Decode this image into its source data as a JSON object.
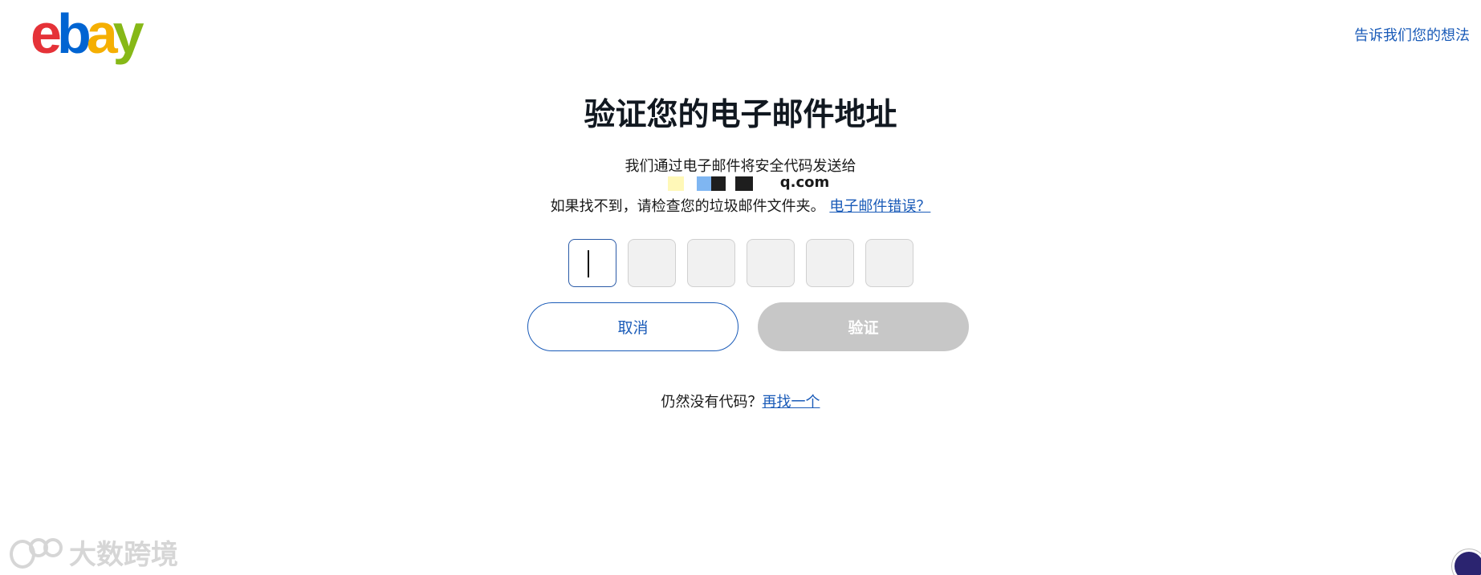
{
  "header": {
    "logo_text": {
      "e": "e",
      "b": "b",
      "a": "a",
      "y": "y"
    },
    "feedback_link": "告诉我们您的想法"
  },
  "main": {
    "title": "验证您的电子邮件地址",
    "sent_to_text": "我们通过电子邮件将安全代码发送给",
    "email_visible_suffix": "q.com",
    "spam_hint": "如果找不到，请检查您的垃圾邮件文件夹。",
    "wrong_email_link": "电子邮件错误？",
    "code_boxes": [
      "",
      "",
      "",
      "",
      "",
      ""
    ],
    "cancel_button": "取消",
    "verify_button": "验证",
    "no_code_text": "仍然没有代码？",
    "resend_link": "再找一个"
  },
  "watermark": {
    "text": "大数跨境"
  },
  "colors": {
    "link": "#1a5bb8",
    "verify_disabled_bg": "#c7c7c7",
    "code_box_bg": "#f1f1f1",
    "logo_e": "#e53238",
    "logo_b": "#0064d2",
    "logo_a": "#f5af02",
    "logo_y": "#86b817"
  }
}
